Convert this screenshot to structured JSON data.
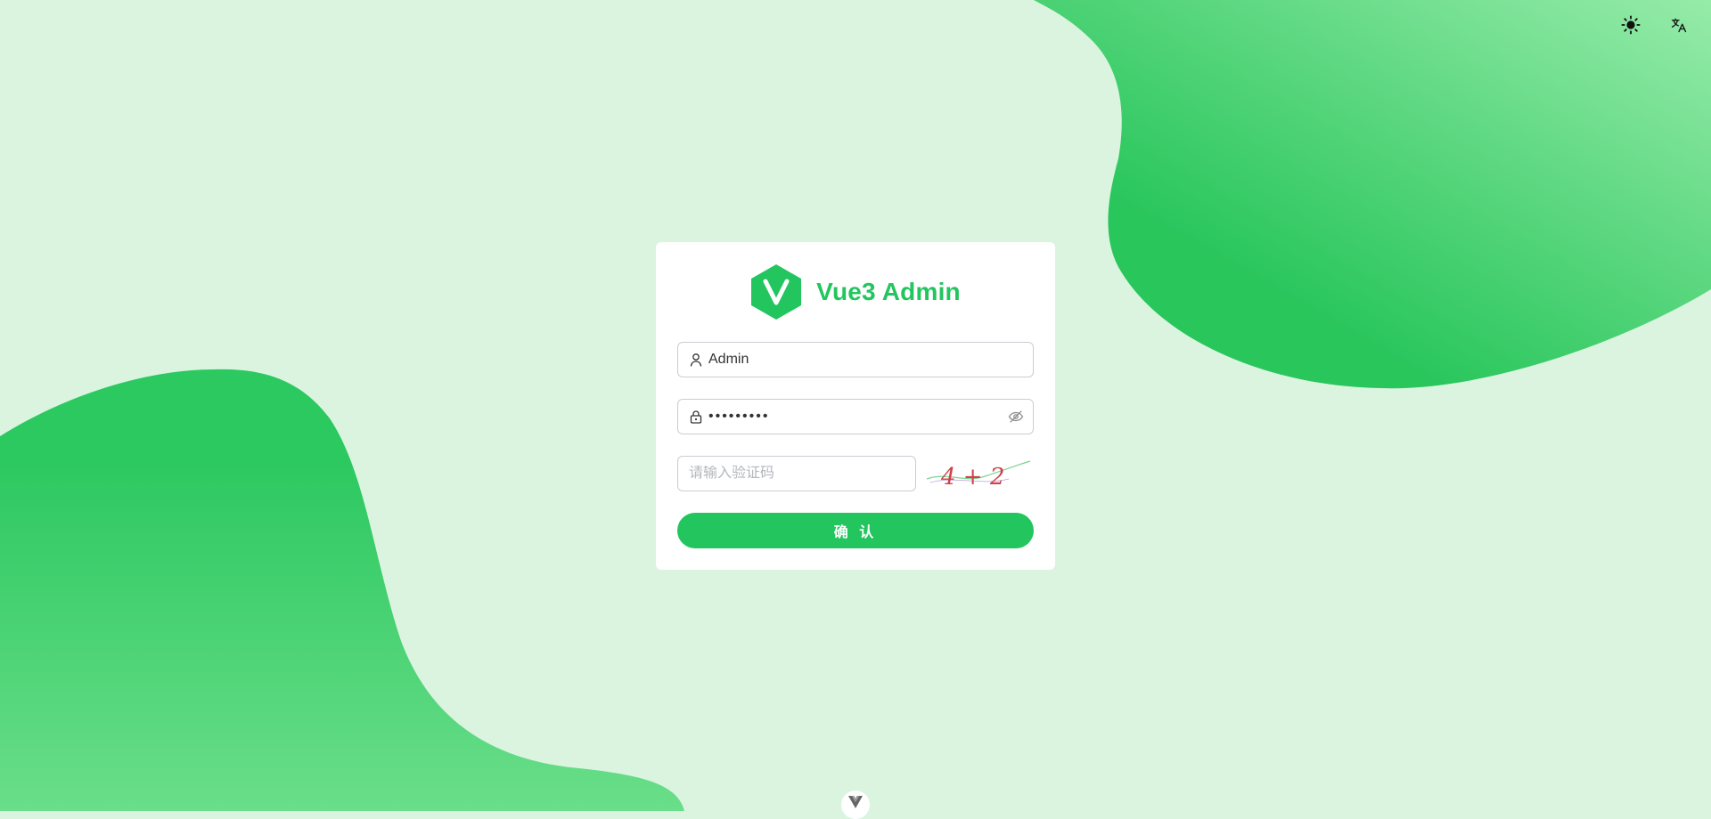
{
  "colors": {
    "background": "#dbf4df",
    "accent": "#22c55e",
    "blob_light": "#8ee8a3"
  },
  "toolbar": {
    "theme_icon": "sun-icon",
    "language_icon": "translate-icon"
  },
  "brand": {
    "logo_icon": "hexagon-v-logo",
    "title": "Vue3 Admin"
  },
  "form": {
    "username": {
      "value": "Admin",
      "icon": "user-icon"
    },
    "password": {
      "value": "•••••••••",
      "icon": "lock-icon",
      "toggle_icon": "eye-off-icon"
    },
    "captcha": {
      "placeholder": "请输入验证码",
      "image_text": "4 + 2"
    },
    "submit_label": "确 认"
  },
  "footer": {
    "badge_icon": "vue-logo-icon"
  }
}
